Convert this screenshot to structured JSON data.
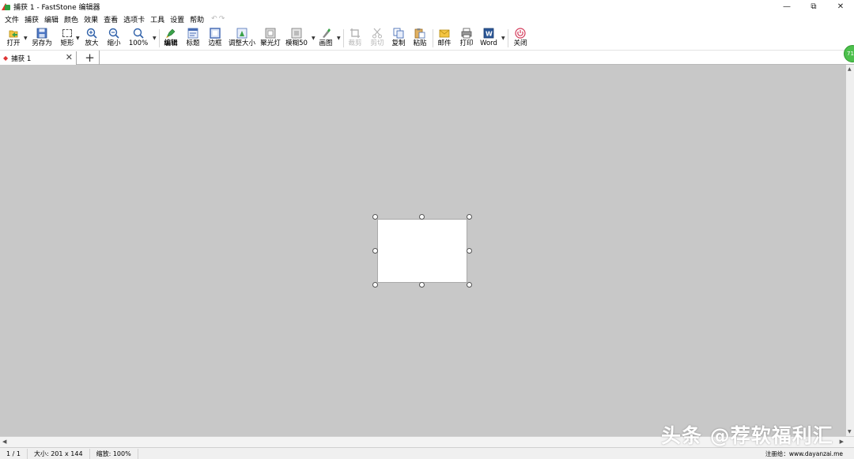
{
  "window": {
    "title": "捕获 1 - FastStone 编辑器",
    "controls": [
      "minimize",
      "restore",
      "close"
    ]
  },
  "menu": [
    "文件",
    "捕获",
    "编辑",
    "颜色",
    "效果",
    "查看",
    "选项卡",
    "工具",
    "设置",
    "帮助"
  ],
  "toolbar": {
    "open": "打开",
    "save_as": "另存为",
    "rect": "矩形",
    "zoom_in": "放大",
    "zoom_out": "缩小",
    "zoom_pct": "100%",
    "edit": "编辑",
    "caption": "标题",
    "border": "边框",
    "resize": "调整大小",
    "spotlight": "聚光灯",
    "blur": "模糊50",
    "draw": "画图",
    "crop": "裁剪",
    "cut": "剪切",
    "copy": "复制",
    "paste": "粘贴",
    "email": "邮件",
    "print": "打印",
    "word": "Word",
    "close": "关闭"
  },
  "tabs": [
    {
      "label": "捕获 1",
      "active": true
    }
  ],
  "side_badge": "71",
  "status": {
    "page": "1 / 1",
    "size": "大小: 201 x 144",
    "zoom": "缩放: 100%",
    "registered": "注册给：www.dayanzai.me"
  },
  "watermark": "头条 @荐软福利汇",
  "colors": {
    "canvas_bg": "#c8c8c8",
    "image_bg": "#ffffff",
    "tab_marker": "#dd3333",
    "badge": "#4cc04c"
  }
}
